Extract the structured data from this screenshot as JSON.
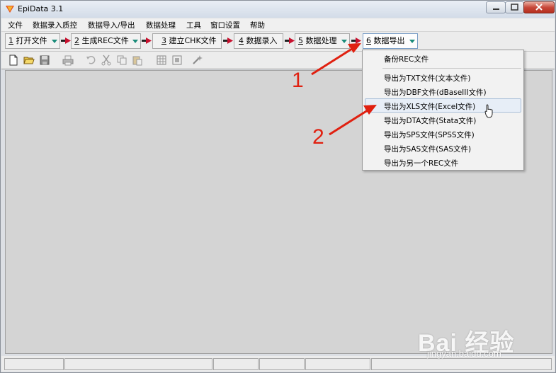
{
  "window": {
    "title": "EpiData 3.1"
  },
  "menubar": {
    "items": [
      "文件",
      "数据录入质控",
      "数据导入/导出",
      "数据处理",
      "工具",
      "窗口设置",
      "帮助"
    ]
  },
  "steps": [
    {
      "num": "1",
      "label": "打开文件"
    },
    {
      "num": "2",
      "label": "生成REC文件"
    },
    {
      "num": "3",
      "label": "建立CHK文件"
    },
    {
      "num": "4",
      "label": "数据录入"
    },
    {
      "num": "5",
      "label": "数据处理"
    },
    {
      "num": "6",
      "label": "数据导出"
    }
  ],
  "toolbar_icons": [
    "new-file-icon",
    "open-folder-icon",
    "save-icon",
    "print-icon",
    "undo-icon",
    "cut-icon",
    "copy-icon",
    "paste-icon",
    "calculator-icon",
    "grid-icon",
    "magic-icon"
  ],
  "dropdown": {
    "backup": "备份REC文件",
    "items": [
      "导出为TXT文件(文本文件)",
      "导出为DBF文件(dBaseIII文件)",
      "导出为XLS文件(Excel文件)",
      "导出为DTA文件(Stata文件)",
      "导出为SPS文件(SPSS文件)",
      "导出为SAS文件(SAS文件)",
      "导出为另一个REC文件"
    ],
    "highlighted_index": 2
  },
  "annotations": {
    "n1": "1",
    "n2": "2",
    "color": "#e02010"
  },
  "watermark": {
    "brand": "Bai 经验",
    "url": "jingyan.baidu.com"
  }
}
